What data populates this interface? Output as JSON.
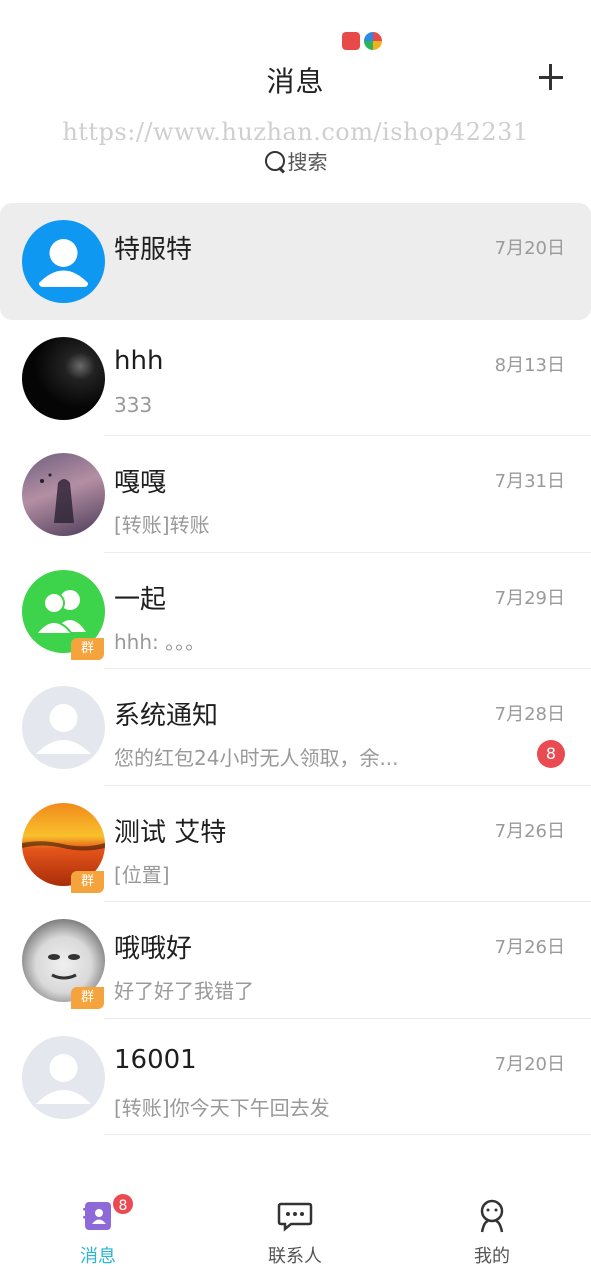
{
  "header": {
    "title": "消息",
    "add_icon": "plus-icon"
  },
  "watermark": "https://www.huzhan.com/ishop42231",
  "search": {
    "label": "搜索",
    "icon": "search-icon"
  },
  "conversations": [
    {
      "name": "特服特",
      "time": "7月20日",
      "preview": "",
      "avatar": "default-person-blue",
      "group": false,
      "unread": null,
      "highlight": true
    },
    {
      "name": "hhh",
      "time": "8月13日",
      "preview": "333",
      "avatar": "photo-dark",
      "group": false,
      "unread": null
    },
    {
      "name": "嘎嘎",
      "time": "7月31日",
      "preview": "[转账]转账",
      "avatar": "photo-anime",
      "group": false,
      "unread": null
    },
    {
      "name": "一起",
      "time": "7月29日",
      "preview": "hhh: 。。。",
      "avatar": "group-green",
      "group": true,
      "group_tag": "群",
      "unread": null
    },
    {
      "name": "系统通知",
      "time": "7月28日",
      "preview": "您的红包24小时无人领取，余...",
      "avatar": "default-person-gray",
      "group": false,
      "unread": "8"
    },
    {
      "name": "测试 艾特",
      "time": "7月26日",
      "preview": "[位置]",
      "avatar": "photo-sunset",
      "group": true,
      "group_tag": "群",
      "unread": null
    },
    {
      "name": "哦哦好",
      "time": "7月26日",
      "preview": "好了好了我错了",
      "avatar": "photo-meme-face",
      "group": true,
      "group_tag": "群",
      "unread": null
    },
    {
      "name": "16001",
      "time": "7月20日",
      "preview": "[转账]你今天下午回去发",
      "avatar": "default-person-gray",
      "group": false,
      "unread": null
    }
  ],
  "tabbar": {
    "messages": {
      "label": "消息",
      "badge": "8",
      "icon": "messages-book-icon",
      "active": true
    },
    "contacts": {
      "label": "联系人",
      "icon": "chat-bubble-icon"
    },
    "me": {
      "label": "我的",
      "icon": "person-outline-icon"
    }
  },
  "colors": {
    "accent": "#2db6d4",
    "badge": "#ea4b53",
    "group_tag": "#f5a33c",
    "highlight_row": "#ededed"
  }
}
